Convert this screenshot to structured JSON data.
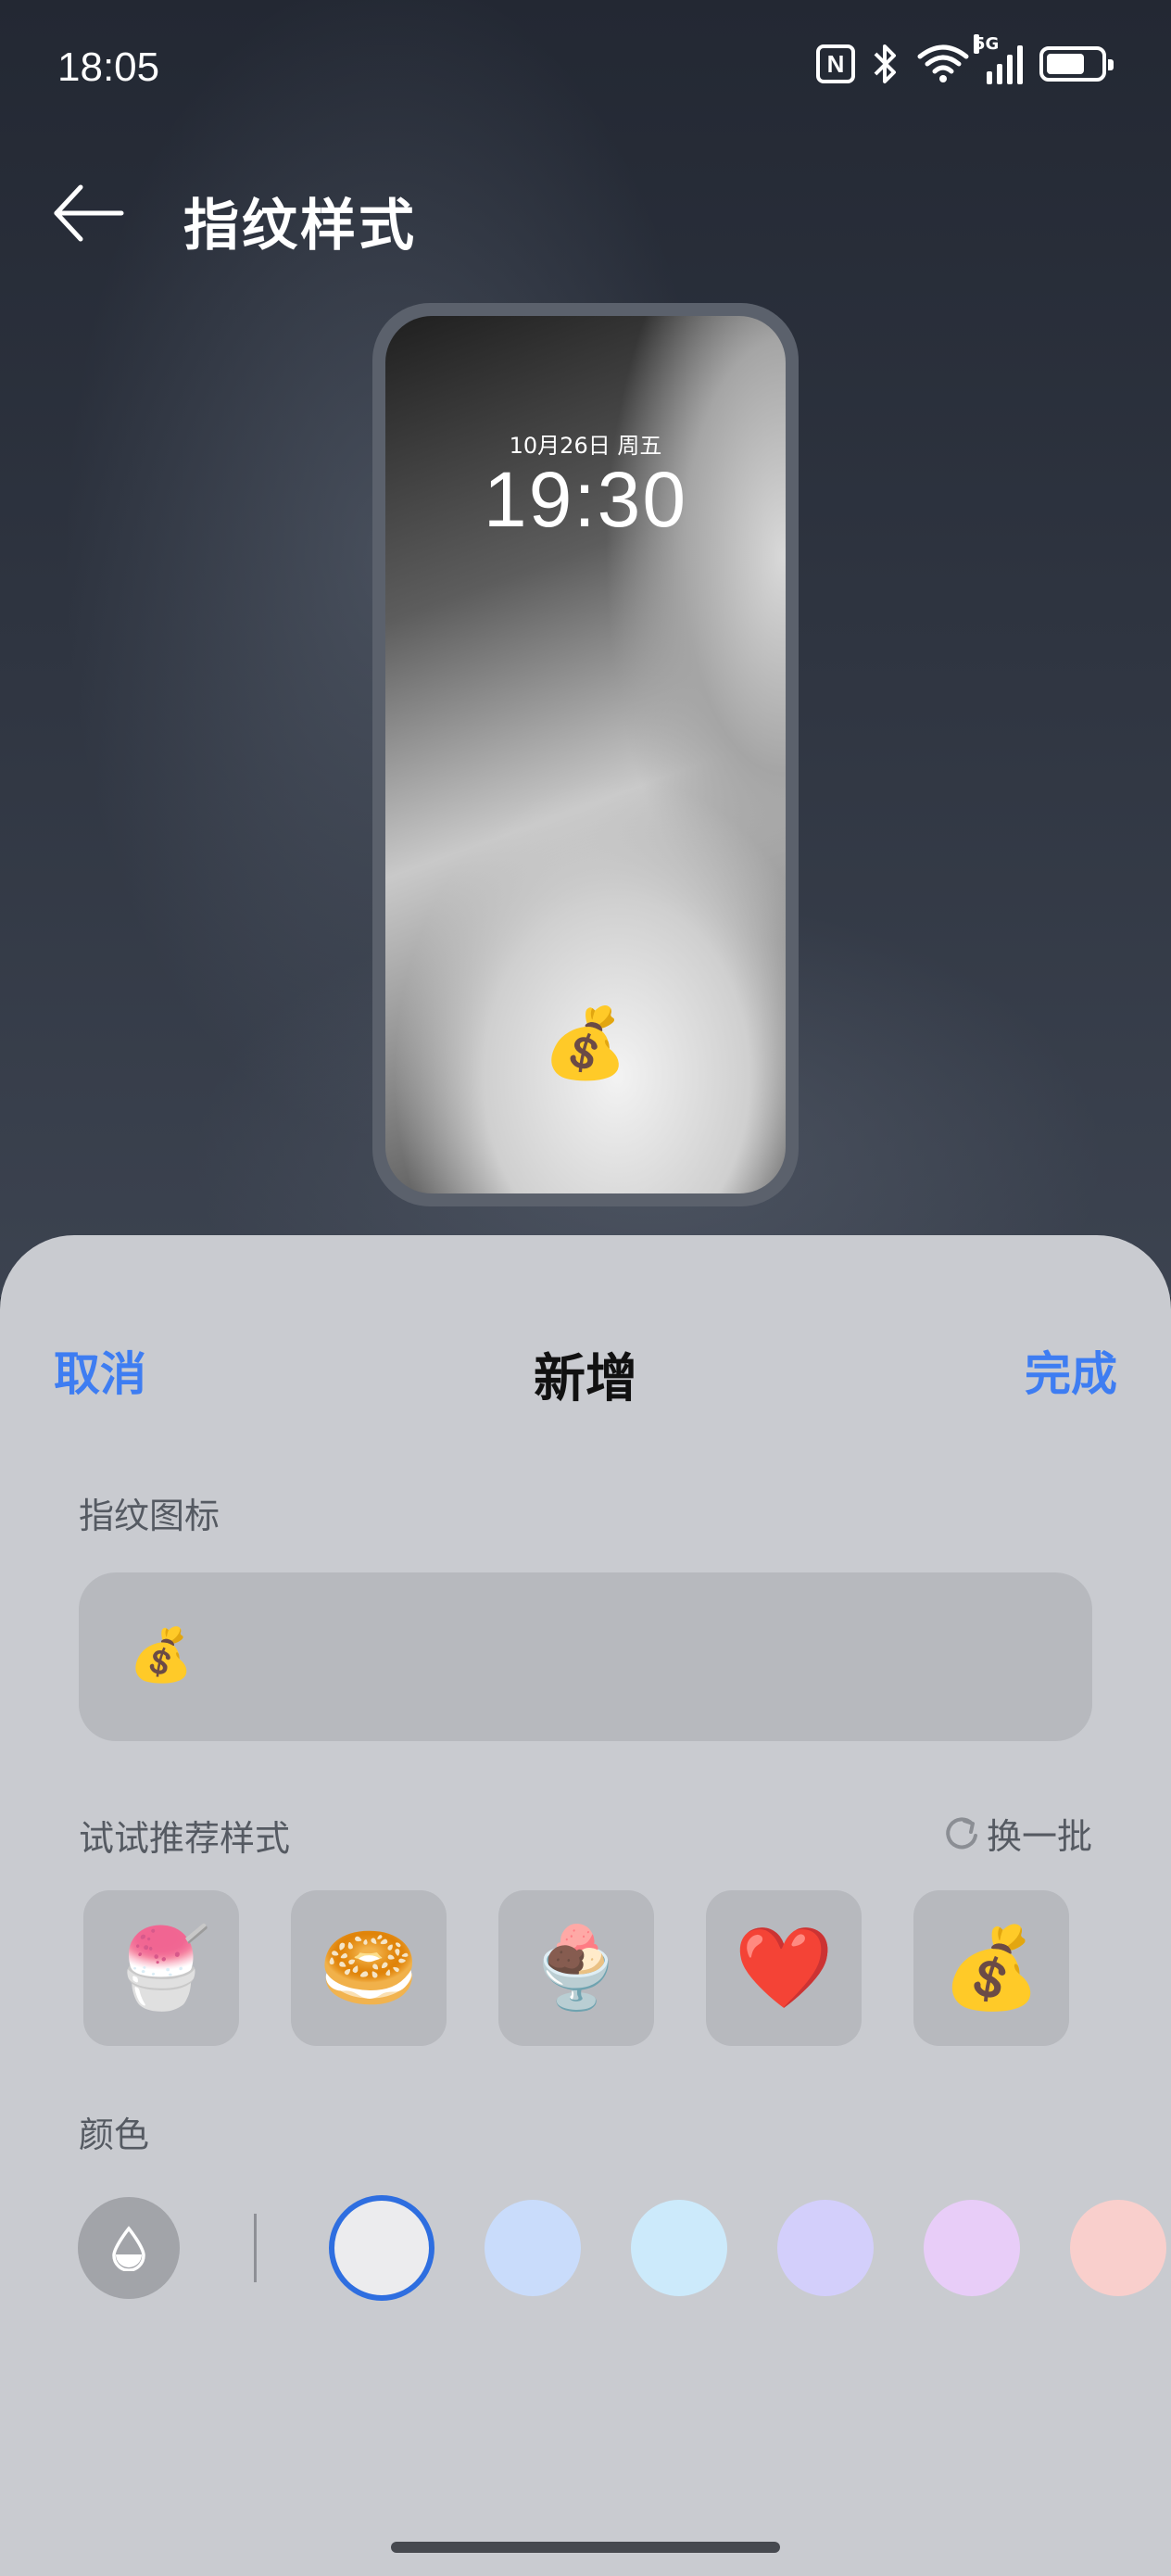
{
  "status_bar": {
    "time": "18:05",
    "nfc_label": "N",
    "network_label": "5G",
    "battery_level": 0.72
  },
  "header": {
    "title": "指纹样式",
    "back_icon": "arrow-left-icon"
  },
  "preview": {
    "date": "10月26日 周五",
    "time": "19:30",
    "fingerprint_icon": "💰"
  },
  "sheet": {
    "cancel_label": "取消",
    "title": "新增",
    "done_label": "完成",
    "icon_section_label": "指纹图标",
    "icon_value": "💰",
    "suggest_label": "试试推荐样式",
    "refresh_label": "换一批",
    "suggestions": [
      "🍧",
      "🥯",
      "🍨",
      "❤️",
      "💰"
    ],
    "color_label": "颜色",
    "colors": [
      "#ececee",
      "#c9dcfb",
      "#cceafb",
      "#d3cffb",
      "#e8cdf8",
      "#f9cfcc"
    ],
    "selected_color_index": 0
  }
}
